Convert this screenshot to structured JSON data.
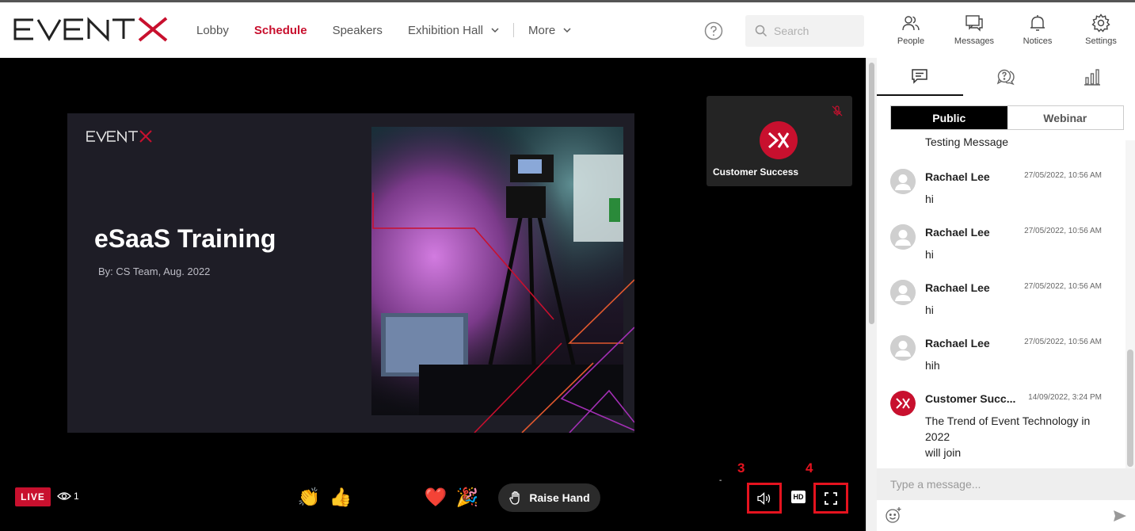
{
  "brand": {
    "name": "EVENTX",
    "accent": "#c8102e"
  },
  "nav": {
    "items": [
      {
        "label": "Lobby",
        "active": false,
        "dropdown": false
      },
      {
        "label": "Schedule",
        "active": true,
        "dropdown": false
      },
      {
        "label": "Speakers",
        "active": false,
        "dropdown": false
      },
      {
        "label": "Exhibition Hall",
        "active": false,
        "dropdown": true
      },
      {
        "label": "More",
        "active": false,
        "dropdown": true
      }
    ]
  },
  "search": {
    "placeholder": "Search"
  },
  "toolbar": {
    "people": "People",
    "messages": "Messages",
    "notices": "Notices",
    "settings": "Settings"
  },
  "stage": {
    "slide": {
      "title": "eSaaS Training",
      "subtitle": "By: CS Team, Aug. 2022"
    },
    "tile": {
      "name": "Customer Success",
      "muted": true
    },
    "live_label": "LIVE",
    "viewer_count": "1",
    "reactions": [
      "😂",
      "👏",
      "👍",
      "😍",
      "😎",
      "❤️",
      "🎉"
    ],
    "raise_hand_label": "Raise Hand",
    "dash": "-",
    "annotation_volume": "3",
    "annotation_fullscreen": "4",
    "hd_label": "HD"
  },
  "chat": {
    "tabs": [
      "chat-icon",
      "qa-icon",
      "poll-icon"
    ],
    "segments": {
      "public": "Public",
      "webinar": "Webinar"
    },
    "partial_message": "Testing Message",
    "messages": [
      {
        "name": "Rachael Lee",
        "time": "27/05/2022, 10:56 AM",
        "text": "hi"
      },
      {
        "name": "Rachael Lee",
        "time": "27/05/2022, 10:56 AM",
        "text": "hi"
      },
      {
        "name": "Rachael Lee",
        "time": "27/05/2022, 10:56 AM",
        "text": "hi"
      },
      {
        "name": "Rachael Lee",
        "time": "27/05/2022, 10:56 AM",
        "text": "hih"
      },
      {
        "name": "Customer Succ...",
        "time": "14/09/2022, 3:24 PM",
        "text": "The Trend of Event Technology in 2022",
        "text2": "will join"
      }
    ],
    "input_placeholder": "Type a message..."
  }
}
